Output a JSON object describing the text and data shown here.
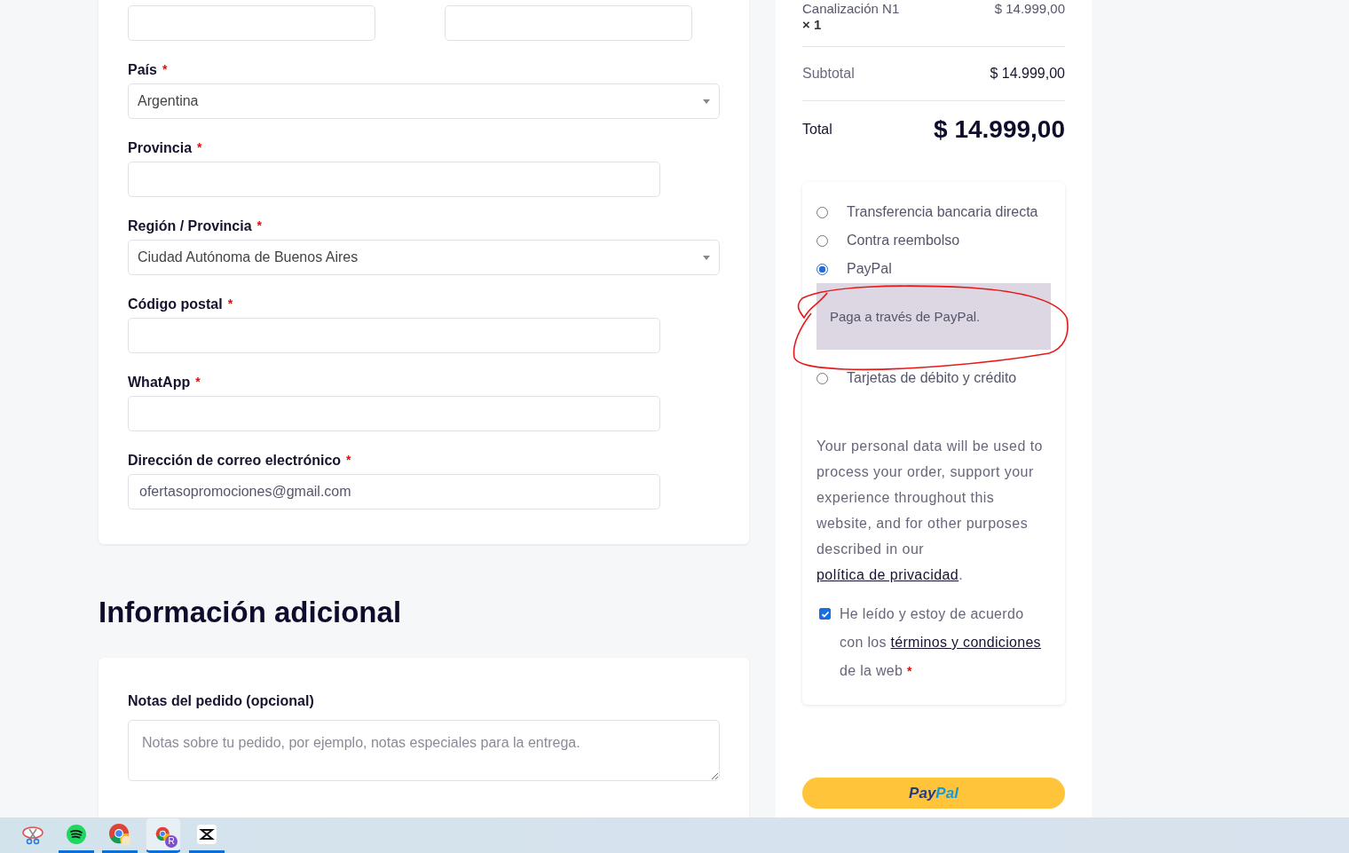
{
  "billing_form": {
    "top_fields": [
      {
        "kind": "text"
      },
      {
        "kind": "text"
      }
    ],
    "fields": [
      {
        "label": "País",
        "required_mark": "*",
        "kind": "select",
        "value": "Argentina"
      },
      {
        "label": "Provincia",
        "required_mark": "*",
        "kind": "text"
      },
      {
        "label": "Región / Provincia",
        "required_mark": "*",
        "kind": "select",
        "value": "Ciudad Autónoma de Buenos Aires"
      },
      {
        "label": "Código postal",
        "required_mark": "*",
        "kind": "text"
      },
      {
        "label": "WhatApp",
        "required_mark": "*",
        "kind": "text"
      },
      {
        "label": "Dirección de correo electrónico",
        "required_mark": "*",
        "kind": "text",
        "value": "ofertasopromociones@gmail.com"
      }
    ]
  },
  "additional_info": {
    "heading": "Información adicional",
    "notes_label": "Notas del pedido (opcional)",
    "notes_placeholder": "Notas sobre tu pedido, por ejemplo, notas especiales para la entrega."
  },
  "order_summary": {
    "product_name": "Canalización N1",
    "product_price": "$ 14.999,00",
    "quantity": "× 1",
    "subtotal_label": "Subtotal",
    "subtotal": "$ 14.999,00",
    "total_label": "Total",
    "total": "$ 14.999,00"
  },
  "payment": {
    "methods": [
      {
        "label": "Transferencia bancaria directa",
        "selected": false
      },
      {
        "label": "Contra reembolso",
        "selected": false
      },
      {
        "label": "PayPal",
        "selected": true,
        "description": "Paga a través de PayPal."
      },
      {
        "label": "Tarjetas de débito y crédito",
        "selected": false
      }
    ],
    "privacy_text": "Your personal data will be used to process your order, support your experience throughout this website, and for other purposes described in our",
    "privacy_link": "política de privacidad",
    "privacy_end": ".",
    "terms": {
      "checked": true,
      "before": "He leído y estoy de acuerdo con los",
      "link": "términos y condiciones",
      "after": "de la web",
      "required_mark": "*"
    },
    "paypal_button": {
      "logo_dark": "Pay",
      "logo_light": "Pal"
    }
  },
  "taskbar": {
    "apps": [
      {
        "kind": "snip",
        "open": false,
        "selected": false
      },
      {
        "kind": "music",
        "open": true,
        "selected": false
      },
      {
        "kind": "browser",
        "open": true,
        "selected": false
      },
      {
        "kind": "browser",
        "badge": "R",
        "open": true,
        "selected": true
      },
      {
        "kind": "editor",
        "open": true,
        "selected": false
      }
    ]
  }
}
